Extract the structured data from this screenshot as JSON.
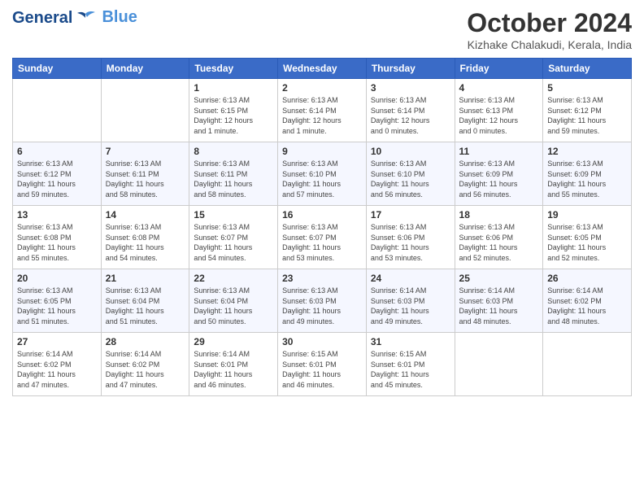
{
  "header": {
    "logo": {
      "line1": "General",
      "line2": "Blue"
    },
    "title": "October 2024",
    "location": "Kizhake Chalakudi, Kerala, India"
  },
  "days_of_week": [
    "Sunday",
    "Monday",
    "Tuesday",
    "Wednesday",
    "Thursday",
    "Friday",
    "Saturday"
  ],
  "weeks": [
    [
      {
        "day": "",
        "info": ""
      },
      {
        "day": "",
        "info": ""
      },
      {
        "day": "1",
        "info": "Sunrise: 6:13 AM\nSunset: 6:15 PM\nDaylight: 12 hours\nand 1 minute."
      },
      {
        "day": "2",
        "info": "Sunrise: 6:13 AM\nSunset: 6:14 PM\nDaylight: 12 hours\nand 1 minute."
      },
      {
        "day": "3",
        "info": "Sunrise: 6:13 AM\nSunset: 6:14 PM\nDaylight: 12 hours\nand 0 minutes."
      },
      {
        "day": "4",
        "info": "Sunrise: 6:13 AM\nSunset: 6:13 PM\nDaylight: 12 hours\nand 0 minutes."
      },
      {
        "day": "5",
        "info": "Sunrise: 6:13 AM\nSunset: 6:12 PM\nDaylight: 11 hours\nand 59 minutes."
      }
    ],
    [
      {
        "day": "6",
        "info": "Sunrise: 6:13 AM\nSunset: 6:12 PM\nDaylight: 11 hours\nand 59 minutes."
      },
      {
        "day": "7",
        "info": "Sunrise: 6:13 AM\nSunset: 6:11 PM\nDaylight: 11 hours\nand 58 minutes."
      },
      {
        "day": "8",
        "info": "Sunrise: 6:13 AM\nSunset: 6:11 PM\nDaylight: 11 hours\nand 58 minutes."
      },
      {
        "day": "9",
        "info": "Sunrise: 6:13 AM\nSunset: 6:10 PM\nDaylight: 11 hours\nand 57 minutes."
      },
      {
        "day": "10",
        "info": "Sunrise: 6:13 AM\nSunset: 6:10 PM\nDaylight: 11 hours\nand 56 minutes."
      },
      {
        "day": "11",
        "info": "Sunrise: 6:13 AM\nSunset: 6:09 PM\nDaylight: 11 hours\nand 56 minutes."
      },
      {
        "day": "12",
        "info": "Sunrise: 6:13 AM\nSunset: 6:09 PM\nDaylight: 11 hours\nand 55 minutes."
      }
    ],
    [
      {
        "day": "13",
        "info": "Sunrise: 6:13 AM\nSunset: 6:08 PM\nDaylight: 11 hours\nand 55 minutes."
      },
      {
        "day": "14",
        "info": "Sunrise: 6:13 AM\nSunset: 6:08 PM\nDaylight: 11 hours\nand 54 minutes."
      },
      {
        "day": "15",
        "info": "Sunrise: 6:13 AM\nSunset: 6:07 PM\nDaylight: 11 hours\nand 54 minutes."
      },
      {
        "day": "16",
        "info": "Sunrise: 6:13 AM\nSunset: 6:07 PM\nDaylight: 11 hours\nand 53 minutes."
      },
      {
        "day": "17",
        "info": "Sunrise: 6:13 AM\nSunset: 6:06 PM\nDaylight: 11 hours\nand 53 minutes."
      },
      {
        "day": "18",
        "info": "Sunrise: 6:13 AM\nSunset: 6:06 PM\nDaylight: 11 hours\nand 52 minutes."
      },
      {
        "day": "19",
        "info": "Sunrise: 6:13 AM\nSunset: 6:05 PM\nDaylight: 11 hours\nand 52 minutes."
      }
    ],
    [
      {
        "day": "20",
        "info": "Sunrise: 6:13 AM\nSunset: 6:05 PM\nDaylight: 11 hours\nand 51 minutes."
      },
      {
        "day": "21",
        "info": "Sunrise: 6:13 AM\nSunset: 6:04 PM\nDaylight: 11 hours\nand 51 minutes."
      },
      {
        "day": "22",
        "info": "Sunrise: 6:13 AM\nSunset: 6:04 PM\nDaylight: 11 hours\nand 50 minutes."
      },
      {
        "day": "23",
        "info": "Sunrise: 6:13 AM\nSunset: 6:03 PM\nDaylight: 11 hours\nand 49 minutes."
      },
      {
        "day": "24",
        "info": "Sunrise: 6:14 AM\nSunset: 6:03 PM\nDaylight: 11 hours\nand 49 minutes."
      },
      {
        "day": "25",
        "info": "Sunrise: 6:14 AM\nSunset: 6:03 PM\nDaylight: 11 hours\nand 48 minutes."
      },
      {
        "day": "26",
        "info": "Sunrise: 6:14 AM\nSunset: 6:02 PM\nDaylight: 11 hours\nand 48 minutes."
      }
    ],
    [
      {
        "day": "27",
        "info": "Sunrise: 6:14 AM\nSunset: 6:02 PM\nDaylight: 11 hours\nand 47 minutes."
      },
      {
        "day": "28",
        "info": "Sunrise: 6:14 AM\nSunset: 6:02 PM\nDaylight: 11 hours\nand 47 minutes."
      },
      {
        "day": "29",
        "info": "Sunrise: 6:14 AM\nSunset: 6:01 PM\nDaylight: 11 hours\nand 46 minutes."
      },
      {
        "day": "30",
        "info": "Sunrise: 6:15 AM\nSunset: 6:01 PM\nDaylight: 11 hours\nand 46 minutes."
      },
      {
        "day": "31",
        "info": "Sunrise: 6:15 AM\nSunset: 6:01 PM\nDaylight: 11 hours\nand 45 minutes."
      },
      {
        "day": "",
        "info": ""
      },
      {
        "day": "",
        "info": ""
      }
    ]
  ]
}
